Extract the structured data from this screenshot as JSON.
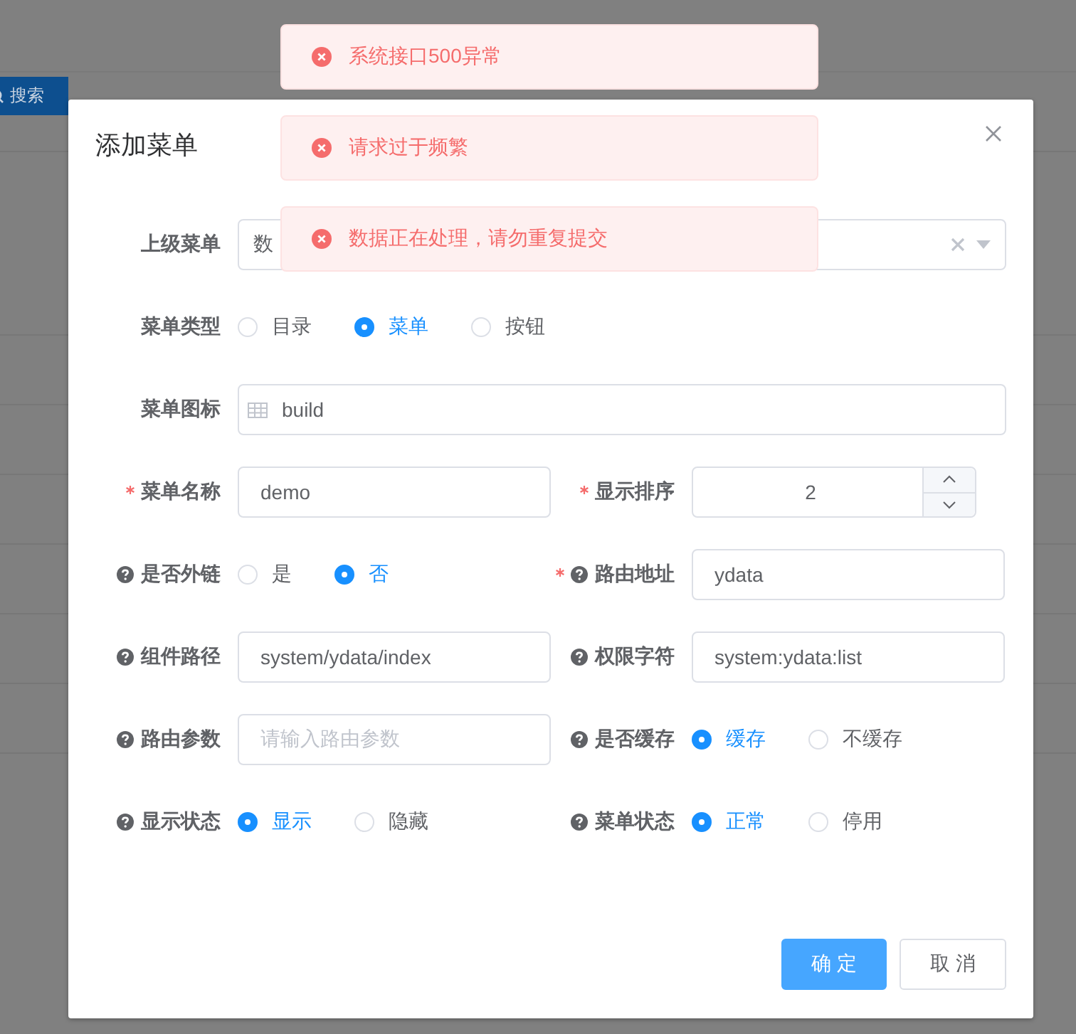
{
  "background": {
    "search_button": "搜索"
  },
  "toasts": [
    {
      "text": "系统接口500异常"
    },
    {
      "text": "请求过于频繁"
    },
    {
      "text": "数据正在处理，请勿重复提交"
    }
  ],
  "dialog": {
    "title": "添加菜单",
    "rows": [
      [
        {
          "label": "上级菜单",
          "required": false,
          "help": false,
          "kind": "select",
          "value": "数"
        }
      ],
      [
        {
          "label": "菜单类型",
          "required": false,
          "help": false,
          "kind": "radio",
          "options": [
            {
              "label": "目录",
              "selected": false
            },
            {
              "label": "菜单",
              "selected": true
            },
            {
              "label": "按钮",
              "selected": false
            }
          ]
        }
      ],
      [
        {
          "label": "菜单图标",
          "required": false,
          "help": false,
          "kind": "icon-input",
          "value": "build"
        }
      ],
      [
        {
          "label": "菜单名称",
          "required": true,
          "help": false,
          "kind": "input",
          "value": "demo"
        },
        {
          "label": "显示排序",
          "required": true,
          "help": false,
          "kind": "number",
          "value": "2"
        }
      ],
      [
        {
          "label": "是否外链",
          "required": false,
          "help": true,
          "kind": "radio",
          "options": [
            {
              "label": "是",
              "selected": false
            },
            {
              "label": "否",
              "selected": true
            }
          ]
        },
        {
          "label": "路由地址",
          "required": true,
          "help": true,
          "kind": "input",
          "value": "ydata"
        }
      ],
      [
        {
          "label": "组件路径",
          "required": false,
          "help": true,
          "kind": "input",
          "value": "system/ydata/index"
        },
        {
          "label": "权限字符",
          "required": false,
          "help": true,
          "kind": "input",
          "value": "system:ydata:list"
        }
      ],
      [
        {
          "label": "路由参数",
          "required": false,
          "help": true,
          "kind": "input",
          "placeholder": "请输入路由参数"
        },
        {
          "label": "是否缓存",
          "required": false,
          "help": true,
          "kind": "radio",
          "options": [
            {
              "label": "缓存",
              "selected": true
            },
            {
              "label": "不缓存",
              "selected": false
            }
          ]
        }
      ],
      [
        {
          "label": "显示状态",
          "required": false,
          "help": true,
          "kind": "radio",
          "options": [
            {
              "label": "显示",
              "selected": true
            },
            {
              "label": "隐藏",
              "selected": false
            }
          ]
        },
        {
          "label": "菜单状态",
          "required": false,
          "help": true,
          "kind": "radio",
          "options": [
            {
              "label": "正常",
              "selected": true
            },
            {
              "label": "停用",
              "selected": false
            }
          ]
        }
      ]
    ],
    "buttons": [
      {
        "label": "确 定",
        "kind": "primary"
      },
      {
        "label": "取 消",
        "kind": "default"
      }
    ]
  }
}
